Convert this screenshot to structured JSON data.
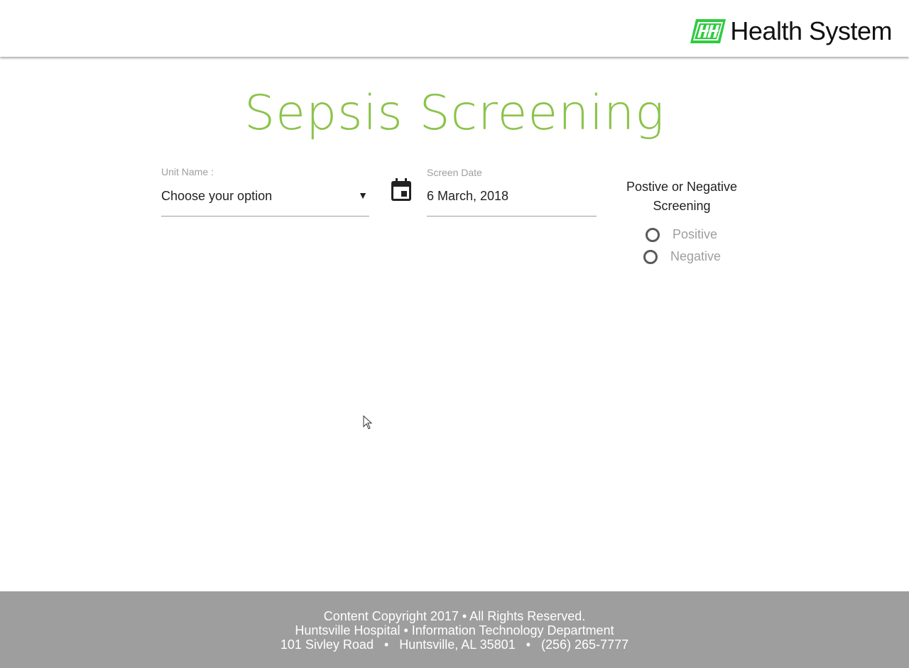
{
  "header": {
    "logo_text": "Health System",
    "logo_mark_color": "#2ecc40"
  },
  "page_title": "Sepsis Screening",
  "form": {
    "unit_name": {
      "label": "Unit Name :",
      "selected": "Choose your option",
      "icon": "triangle-down-icon"
    },
    "screen_date": {
      "icon": "calendar-icon",
      "label": "Screen Date",
      "value": "6 March, 2018"
    },
    "screening_result": {
      "title_line1": "Postive or Negative",
      "title_line2": "Screening",
      "options": [
        {
          "label": "Positive",
          "checked": false
        },
        {
          "label": "Negative",
          "checked": false
        }
      ]
    }
  },
  "footer": {
    "line1": "Content Copyright 2017 • All Rights Reserved.",
    "line2": "Huntsville Hospital • Information Technology Department",
    "line3": "101 Sivley Road   •   Huntsville, AL 35801   •   (256) 265-7777"
  },
  "colors": {
    "title_green": "#8bc34a",
    "footer_bg": "#9e9e9e"
  }
}
